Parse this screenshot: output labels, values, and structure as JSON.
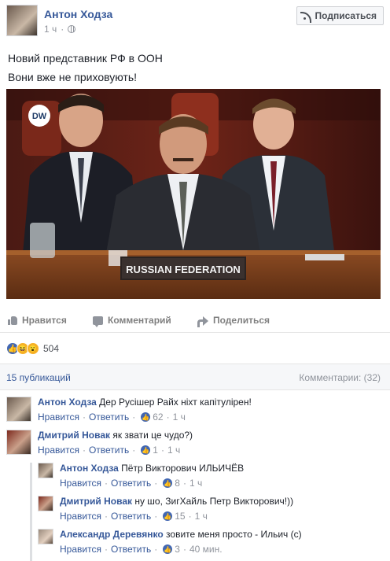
{
  "post": {
    "author": "Антон Ходза",
    "time": "1 ч",
    "dot": "·",
    "subscribe_label": "Подписаться",
    "text_line1": "Новий представник РФ в ООН",
    "text_line2": "Вони вже не приховують!"
  },
  "image": {
    "channel_logo": "DW",
    "nameplate": "RUSSIAN FEDERATION"
  },
  "actions": {
    "like": "Нравится",
    "comment": "Комментарий",
    "share": "Поделиться"
  },
  "reactions": {
    "count": "504",
    "types": [
      "like-icon",
      "haha-icon",
      "wow-icon"
    ]
  },
  "summary": {
    "publications": "15 публикаций",
    "comments": "Комментарии: (32)"
  },
  "comments": [
    {
      "author": "Антон Ходза",
      "text": "Дер Русішер Райх ніхт капітулірен!",
      "like": "Нравится",
      "reply": "Ответить",
      "likes": "62",
      "time": "1 ч"
    },
    {
      "author": "Дмитрий Новак",
      "text": "як звати це чудо?)",
      "like": "Нравится",
      "reply": "Ответить",
      "likes": "1",
      "time": "1 ч"
    },
    {
      "author": "Антон Ходза",
      "text": "Пётр Викторович ИЛЬИЧЁВ",
      "like": "Нравится",
      "reply": "Ответить",
      "likes": "8",
      "time": "1 ч"
    },
    {
      "author": "Дмитрий Новак",
      "text": "ну шо, ЗигХайль Петр Викторович!))",
      "like": "Нравится",
      "reply": "Ответить",
      "likes": "15",
      "time": "1 ч"
    },
    {
      "author": "Александр Деревянко",
      "text": "зовите меня просто - Ильич (с)",
      "like": "Нравится",
      "reply": "Ответить",
      "likes": "3",
      "time": "40 мин."
    }
  ]
}
